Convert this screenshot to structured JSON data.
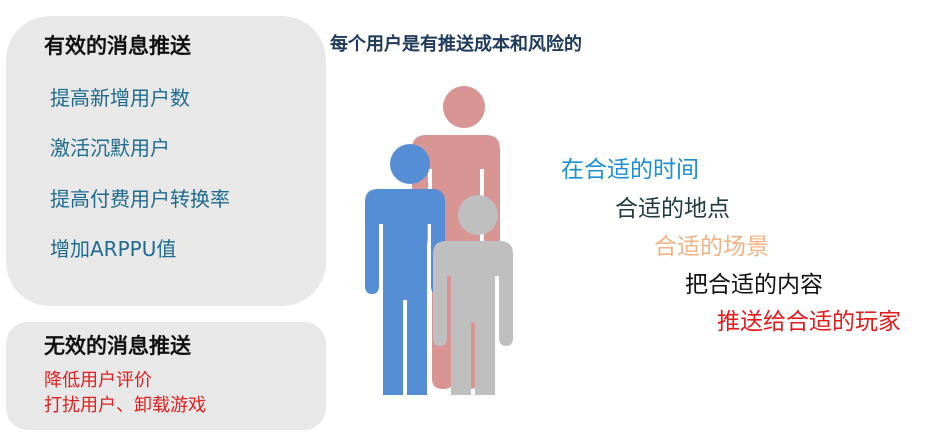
{
  "effective": {
    "title": "有效的消息推送",
    "items": [
      "提高新增用户数",
      "激活沉默用户",
      "提高付费用户转换率",
      "增加ARPPU值"
    ]
  },
  "ineffective": {
    "title": "无效的消息推送",
    "items": [
      "降低用户评价",
      "打扰用户、卸载游戏"
    ]
  },
  "headline": "每个用户是有推送成本和风险的",
  "figures": {
    "icon": "person-icon",
    "colors": {
      "back": "#d99594",
      "left": "#558ed5",
      "front": "#bfbfbf"
    }
  },
  "phrases": [
    {
      "text": "在合适的时间",
      "color": "#1a8fd6"
    },
    {
      "text": "合适的地点",
      "color": "#1f3a44"
    },
    {
      "text": "合适的场景",
      "color": "#f4b183"
    },
    {
      "text": "把合适的内容",
      "color": "#111111"
    },
    {
      "text": "推送给合适的玩家",
      "color": "#e41a1a"
    }
  ]
}
